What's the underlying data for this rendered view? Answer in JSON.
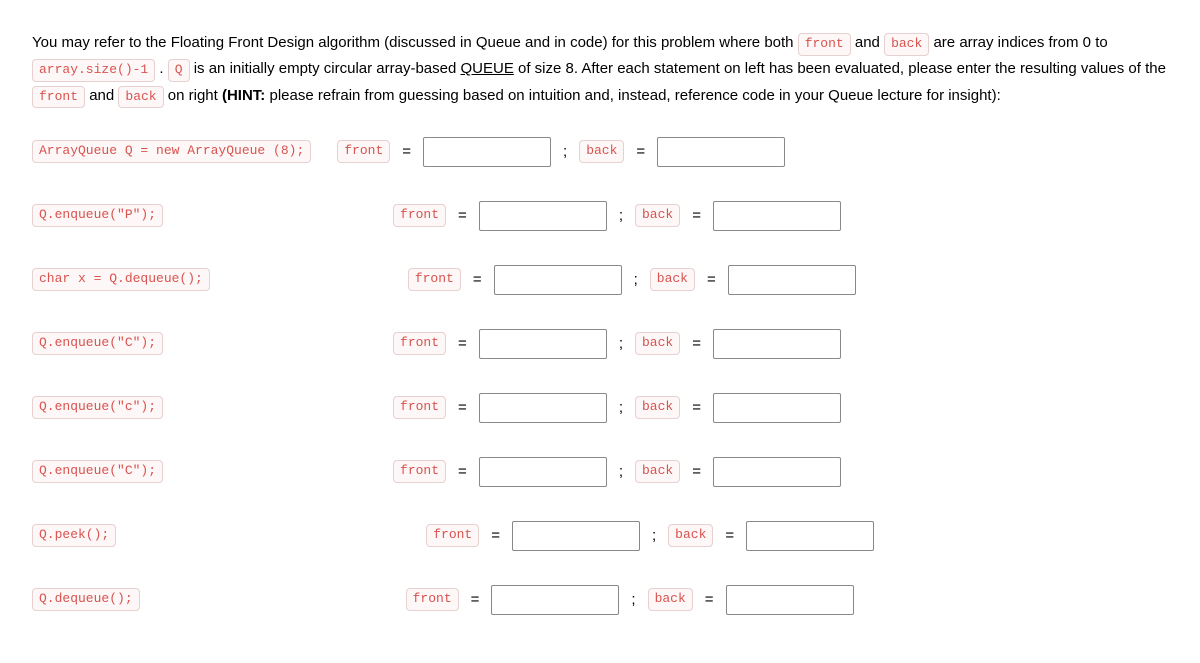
{
  "intro": {
    "t1": "You may refer to the Floating Front Design algorithm (discussed in Queue and in code) for this problem where both ",
    "chip_front": "front",
    "t2": " and ",
    "chip_back": "back",
    "t3": " are array indices from 0 to ",
    "chip_size": "array.size()-1",
    "t4": " . ",
    "chip_Q": "Q",
    "t5": " is an initially empty circular array-based ",
    "queue_word": "QUEUE",
    "t6": " of size 8. After each statement on left has been evaluated, please enter the resulting values of the ",
    "chip_front2": "front",
    "t7": " and ",
    "chip_back2": "back",
    "t8": " on right ",
    "hint_lead": "(HINT:",
    "hint_rest": " please refrain from guessing based on intuition and, instead, reference code in your Queue lecture for insight):"
  },
  "labels": {
    "front": "front",
    "back": "back",
    "eq": "=",
    "semi": ";"
  },
  "rows": [
    {
      "stmt": "ArrayQueue Q = new ArrayQueue (8);",
      "offset": "off-0"
    },
    {
      "stmt": "Q.enqueue(\"P\");",
      "offset": "off-1"
    },
    {
      "stmt": "char x = Q.dequeue();",
      "offset": "off-2"
    },
    {
      "stmt": "Q.enqueue(\"C\");",
      "offset": "off-3"
    },
    {
      "stmt": "Q.enqueue(\"c\");",
      "offset": "off-4"
    },
    {
      "stmt": "Q.enqueue(\"C\");",
      "offset": "off-5"
    },
    {
      "stmt": "Q.peek();",
      "offset": "off-6"
    },
    {
      "stmt": "Q.dequeue();",
      "offset": "off-7"
    }
  ]
}
